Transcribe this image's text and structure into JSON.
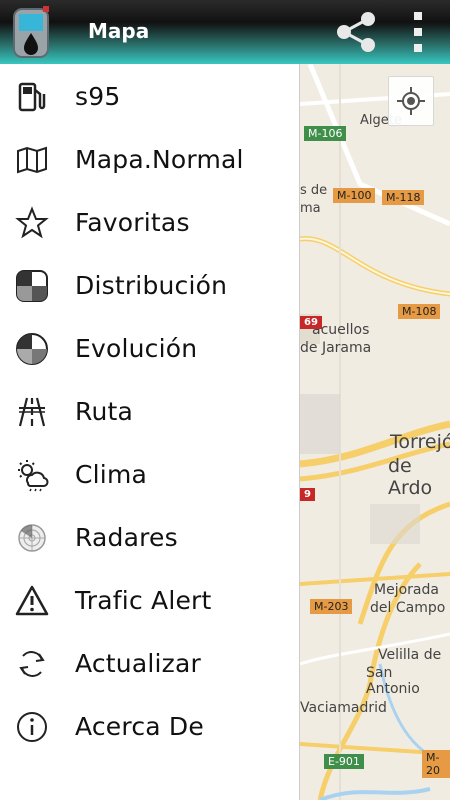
{
  "header": {
    "title": "Mapa"
  },
  "menu": {
    "items": [
      {
        "label": "s95",
        "icon": "fuel-pump-icon"
      },
      {
        "label": "Mapa.Normal",
        "icon": "map-icon"
      },
      {
        "label": "Favoritas",
        "icon": "star-icon"
      },
      {
        "label": "Distribución",
        "icon": "distribution-chart-icon"
      },
      {
        "label": "Evolución",
        "icon": "evolution-chart-icon"
      },
      {
        "label": "Ruta",
        "icon": "road-icon"
      },
      {
        "label": "Clima",
        "icon": "weather-icon"
      },
      {
        "label": "Radares",
        "icon": "radar-icon"
      },
      {
        "label": "Trafic Alert",
        "icon": "warning-icon"
      },
      {
        "label": "Actualizar",
        "icon": "refresh-icon"
      },
      {
        "label": "Acerca De",
        "icon": "info-icon"
      }
    ]
  },
  "map": {
    "roads": [
      "M-106",
      "M-100",
      "M-118",
      "M-108",
      "M-203",
      "E-901",
      "M-20"
    ],
    "towns": {
      "algete": "Algete",
      "de_frag": "s de",
      "ma_frag": "ma",
      "paracuellos_1": "acuellos",
      "paracuellos_2": "de Jarama",
      "torrejon_1": "Torrejó",
      "torrejon_2": "de Ardo",
      "mejorada_1": "Mejorada",
      "mejorada_2": "del Campo",
      "velilla_1": "Velilla de",
      "velilla_2": "San Antonio",
      "vaciamadrid": "Vaciamadrid"
    },
    "badges": [
      "69",
      "9"
    ]
  },
  "colors": {
    "accent": "#37c7c0",
    "header_dark": "#111111",
    "map_bg": "#f1ece2",
    "road_yellow": "#f6cf6a"
  }
}
